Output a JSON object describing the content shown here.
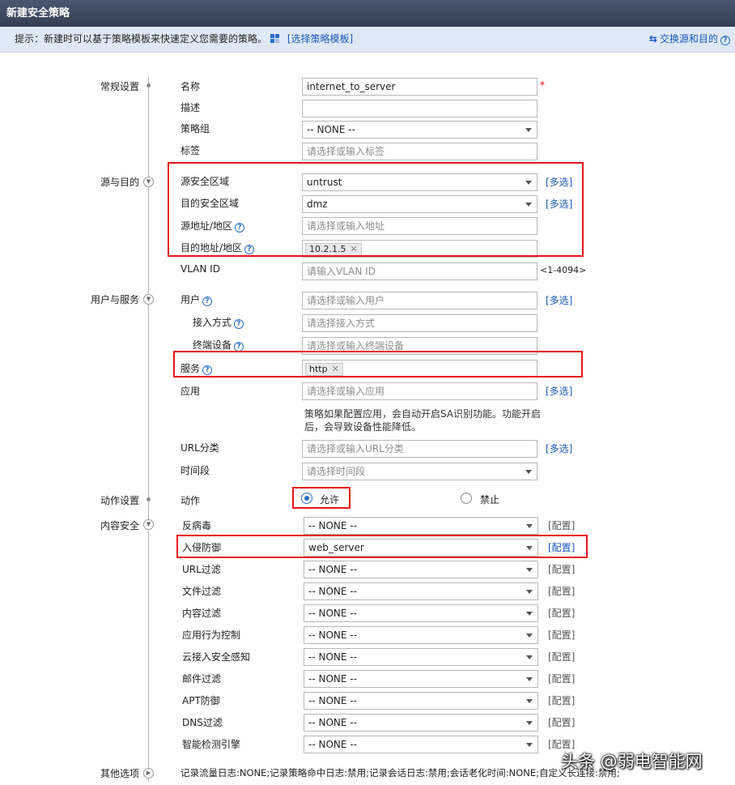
{
  "window": {
    "title": "新建安全策略"
  },
  "hint": {
    "text": "提示：新建时可以基于策略模板来快速定义您需要的策略。",
    "template_link": "[选择策略模板]",
    "swap_link": "交换源和目的"
  },
  "sections": {
    "general": "常规设置",
    "src_dst": "源与目的",
    "user_service": "用户与服务",
    "action": "动作设置",
    "content_security": "内容安全",
    "other": "其他选项"
  },
  "general": {
    "name_label": "名称",
    "name_value": "internet_to_server",
    "required_mark": "*",
    "desc_label": "描述",
    "group_label": "策略组",
    "group_value": "-- NONE --",
    "tag_label": "标签",
    "tag_placeholder": "请选择或输入标签"
  },
  "src_dst": {
    "src_zone_label": "源安全区域",
    "src_zone_value": "untrust",
    "dst_zone_label": "目的安全区域",
    "dst_zone_value": "dmz",
    "src_addr_label": "源地址/地区",
    "src_addr_placeholder": "请选择或输入地址",
    "dst_addr_label": "目的地址/地区",
    "dst_addr_tag": "10.2.1.5",
    "vlan_label": "VLAN ID",
    "vlan_placeholder": "请输入VLAN ID",
    "vlan_range": "<1-4094>",
    "multi_link": "[多选]"
  },
  "user_service": {
    "user_label": "用户",
    "user_placeholder": "请选择或输入用户",
    "access_label": "接入方式",
    "access_placeholder": "请选择接入方式",
    "terminal_label": "终端设备",
    "terminal_placeholder": "请选择或输入终端设备",
    "service_label": "服务",
    "service_tag": "http",
    "app_label": "应用",
    "app_placeholder": "请选择或输入应用",
    "app_note_1": "策略如果配置应用，会自动开启SA识别功能。功能开启",
    "app_note_2": "后，会导致设备性能降低。",
    "url_cat_label": "URL分类",
    "url_cat_placeholder": "请选择或输入URL分类",
    "time_label": "时间段",
    "time_placeholder": "请选择时间段",
    "multi_link": "[多选]"
  },
  "action": {
    "label": "动作",
    "permit": "允许",
    "deny": "禁止",
    "selected": "permit"
  },
  "content_security": {
    "config_link": "[配置]",
    "items": [
      {
        "label": "反病毒",
        "value": "-- NONE --"
      },
      {
        "label": "入侵防御",
        "value": "web_server"
      },
      {
        "label": "URL过滤",
        "value": "-- NONE --"
      },
      {
        "label": "文件过滤",
        "value": "-- NONE --"
      },
      {
        "label": "内容过滤",
        "value": "-- NONE --"
      },
      {
        "label": "应用行为控制",
        "value": "-- NONE --"
      },
      {
        "label": "云接入安全感知",
        "value": "-- NONE --"
      },
      {
        "label": "邮件过滤",
        "value": "-- NONE --"
      },
      {
        "label": "APT防御",
        "value": "-- NONE --"
      },
      {
        "label": "DNS过滤",
        "value": "-- NONE --"
      },
      {
        "label": "智能检测引擎",
        "value": "-- NONE --"
      }
    ]
  },
  "other": {
    "summary": "记录流量日志:NONE;记录策略命中日志:禁用;记录会话日志:禁用;会话老化时间:NONE;自定义长连接:禁用;"
  },
  "watermark": "头条 @弱电智能网",
  "colors": {
    "highlight": "#e8141c",
    "link": "#1a58b8",
    "title_bg": "#3b465b",
    "hint_bg": "#dfe9f6"
  }
}
